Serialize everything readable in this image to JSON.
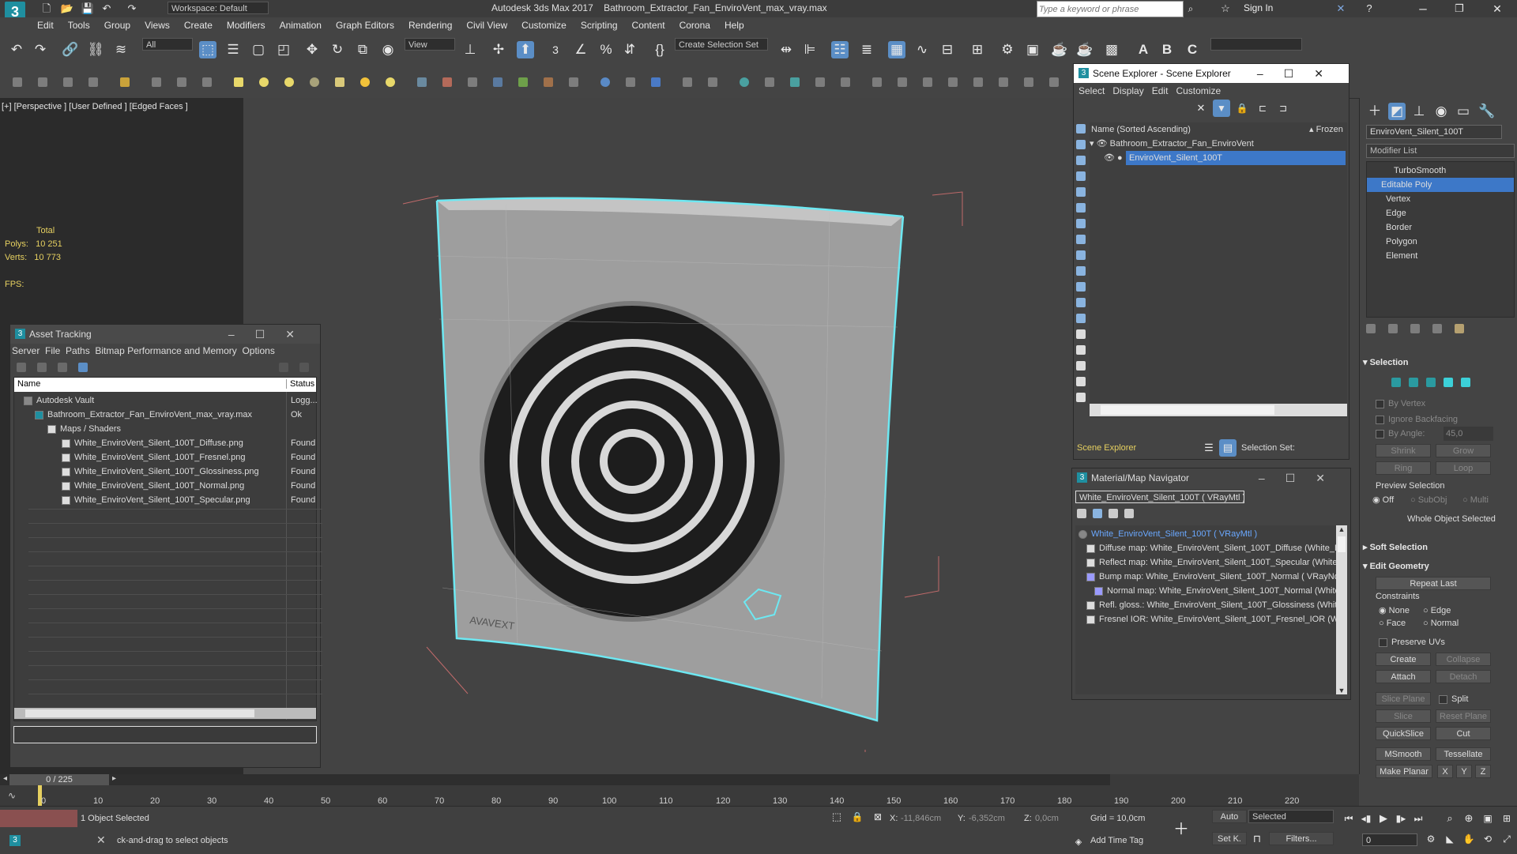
{
  "titlebar": {
    "app_title": "Autodesk 3ds Max 2017",
    "file": "Bathroom_Extractor_Fan_EnviroVent_max_vray.max",
    "workspace": "Workspace: Default",
    "search_placeholder": "Type a keyword or phrase",
    "sign_in": "Sign In"
  },
  "menu": [
    "Edit",
    "Tools",
    "Group",
    "Views",
    "Create",
    "Modifiers",
    "Animation",
    "Graph Editors",
    "Rendering",
    "Civil View",
    "Customize",
    "Scripting",
    "Content",
    "Corona",
    "Help"
  ],
  "toolbar": {
    "filter": "All",
    "view": "View",
    "selection_set": "Create Selection Set"
  },
  "viewport": {
    "label": "[+] [Perspective ] [User Defined ] [Edged Faces ]",
    "total": "Total",
    "polys_label": "Polys:",
    "polys": "10 251",
    "verts_label": "Verts:",
    "verts": "10 773",
    "fps_label": "FPS:",
    "logo_text": "AVAVEXT"
  },
  "asset_tracking": {
    "title": "Asset Tracking",
    "menu": [
      "Server",
      "File",
      "Paths",
      "Bitmap Performance and Memory",
      "Options"
    ],
    "col_name": "Name",
    "col_status": "Status",
    "rows": [
      {
        "name": "Autodesk Vault",
        "status": "Logg..."
      },
      {
        "name": "Bathroom_Extractor_Fan_EnviroVent_max_vray.max",
        "status": "Ok"
      },
      {
        "name": "Maps / Shaders",
        "status": ""
      },
      {
        "name": "White_EnviroVent_Silent_100T_Diffuse.png",
        "status": "Found"
      },
      {
        "name": "White_EnviroVent_Silent_100T_Fresnel.png",
        "status": "Found"
      },
      {
        "name": "White_EnviroVent_Silent_100T_Glossiness.png",
        "status": "Found"
      },
      {
        "name": "White_EnviroVent_Silent_100T_Normal.png",
        "status": "Found"
      },
      {
        "name": "White_EnviroVent_Silent_100T_Specular.png",
        "status": "Found"
      }
    ]
  },
  "scene_explorer": {
    "title": "Scene Explorer - Scene Explorer",
    "menu": [
      "Select",
      "Display",
      "Edit",
      "Customize"
    ],
    "col_name": "Name (Sorted Ascending)",
    "col_frozen": "▴ Frozen",
    "items": [
      "Bathroom_Extractor_Fan_EnviroVent",
      "EnviroVent_Silent_100T"
    ],
    "footer_label": "Scene Explorer",
    "selection_set": "Selection Set:"
  },
  "material_navigator": {
    "title": "Material/Map Navigator",
    "current": "White_EnviroVent_Silent_100T  ( VRayMtl )",
    "items": [
      "White_EnviroVent_Silent_100T  ( VRayMtl )",
      "Diffuse map: White_EnviroVent_Silent_100T_Diffuse (White_E",
      "Reflect map: White_EnviroVent_Silent_100T_Specular (White_",
      "Bump map: White_EnviroVent_Silent_100T_Normal  ( VRayNo",
      "Normal map: White_EnviroVent_Silent_100T_Normal (White_",
      "Refl. gloss.: White_EnviroVent_Silent_100T_Glossiness (White_",
      "Fresnel IOR: White_EnviroVent_Silent_100T_Fresnel_IOR (Whi"
    ]
  },
  "command_panel": {
    "object_name": "EnviroVent_Silent_100T",
    "modifier_list": "Modifier List",
    "stack": [
      "TurboSmooth",
      "Editable Poly",
      "Vertex",
      "Edge",
      "Border",
      "Polygon",
      "Element"
    ],
    "selection_header": "Selection",
    "by_vertex": "By Vertex",
    "ignore_backfacing": "Ignore Backfacing",
    "by_angle": "By Angle:",
    "angle_value": "45,0",
    "shrink": "Shrink",
    "grow": "Grow",
    "ring": "Ring",
    "loop": "Loop",
    "preview_selection": "Preview Selection",
    "off": "Off",
    "subobj": "SubObj",
    "multi": "Multi",
    "whole_object": "Whole Object Selected",
    "soft_selection": "Soft Selection",
    "edit_geometry": "Edit Geometry",
    "repeat_last": "Repeat Last",
    "constraints": "Constraints",
    "none": "None",
    "edge": "Edge",
    "face": "Face",
    "normal": "Normal",
    "preserve_uvs": "Preserve UVs",
    "create": "Create",
    "collapse": "Collapse",
    "attach": "Attach",
    "detach": "Detach",
    "slice_plane": "Slice Plane",
    "split": "Split",
    "slice": "Slice",
    "reset_plane": "Reset Plane",
    "quickslice": "QuickSlice",
    "cut": "Cut",
    "msmooth": "MSmooth",
    "tessellate": "Tessellate",
    "make_planar": "Make Planar",
    "x": "X",
    "y": "Y",
    "z": "Z"
  },
  "timeline": {
    "frame": "0 / 225",
    "ticks": [
      "0",
      "10",
      "20",
      "30",
      "40",
      "50",
      "60",
      "70",
      "80",
      "90",
      "100",
      "110",
      "120",
      "130",
      "140",
      "150",
      "160",
      "170",
      "180",
      "190",
      "200",
      "210",
      "220"
    ]
  },
  "status": {
    "selected": "1 Object Selected",
    "prompt": "ck-and-drag to select objects",
    "x_label": "X:",
    "x": "-11,846cm",
    "y_label": "Y:",
    "y": "-6,352cm",
    "z_label": "Z:",
    "z": "0,0cm",
    "grid": "Grid = 10,0cm",
    "add_time_tag": "Add Time Tag",
    "auto": "Auto",
    "selected_dd": "Selected",
    "set_key": "Set K.",
    "filters": "Filters...",
    "frame_field": "0"
  }
}
